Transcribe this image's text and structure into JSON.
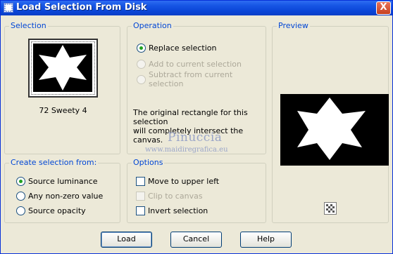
{
  "window": {
    "title": "Load Selection From Disk",
    "close_label": "X"
  },
  "selection": {
    "title": "Selection",
    "thumbnail_label": "72 Sweety 4"
  },
  "operation": {
    "title": "Operation",
    "options": [
      {
        "label": "Replace selection",
        "checked": true,
        "disabled": false
      },
      {
        "label": "Add to current selection",
        "checked": false,
        "disabled": true
      },
      {
        "label": "Subtract from current selection",
        "checked": false,
        "disabled": true
      }
    ],
    "info_line1": "The original rectangle for this selection",
    "info_line2": "will completely intersect the canvas."
  },
  "preview": {
    "title": "Preview",
    "pattern_icon": "checker-pattern-icon"
  },
  "create_from": {
    "title": "Create selection from:",
    "options": [
      {
        "label": "Source luminance",
        "checked": true
      },
      {
        "label": "Any non-zero value",
        "checked": false
      },
      {
        "label": "Source opacity",
        "checked": false
      }
    ]
  },
  "options": {
    "title": "Options",
    "items": [
      {
        "label": "Move to upper left",
        "checked": false,
        "disabled": false
      },
      {
        "label": "Clip to canvas",
        "checked": false,
        "disabled": true
      },
      {
        "label": "Invert selection",
        "checked": false,
        "disabled": false
      }
    ]
  },
  "watermark": {
    "line1": "Pinuccia",
    "line2": "www.maidiregrafica.eu"
  },
  "buttons": {
    "load": "Load",
    "cancel": "Cancel",
    "help": "Help"
  },
  "colors": {
    "titlebar": "#0A45D8",
    "group_title": "#0046D5",
    "dialog_bg": "#ECE9D8",
    "radio_dot": "#21A121"
  }
}
